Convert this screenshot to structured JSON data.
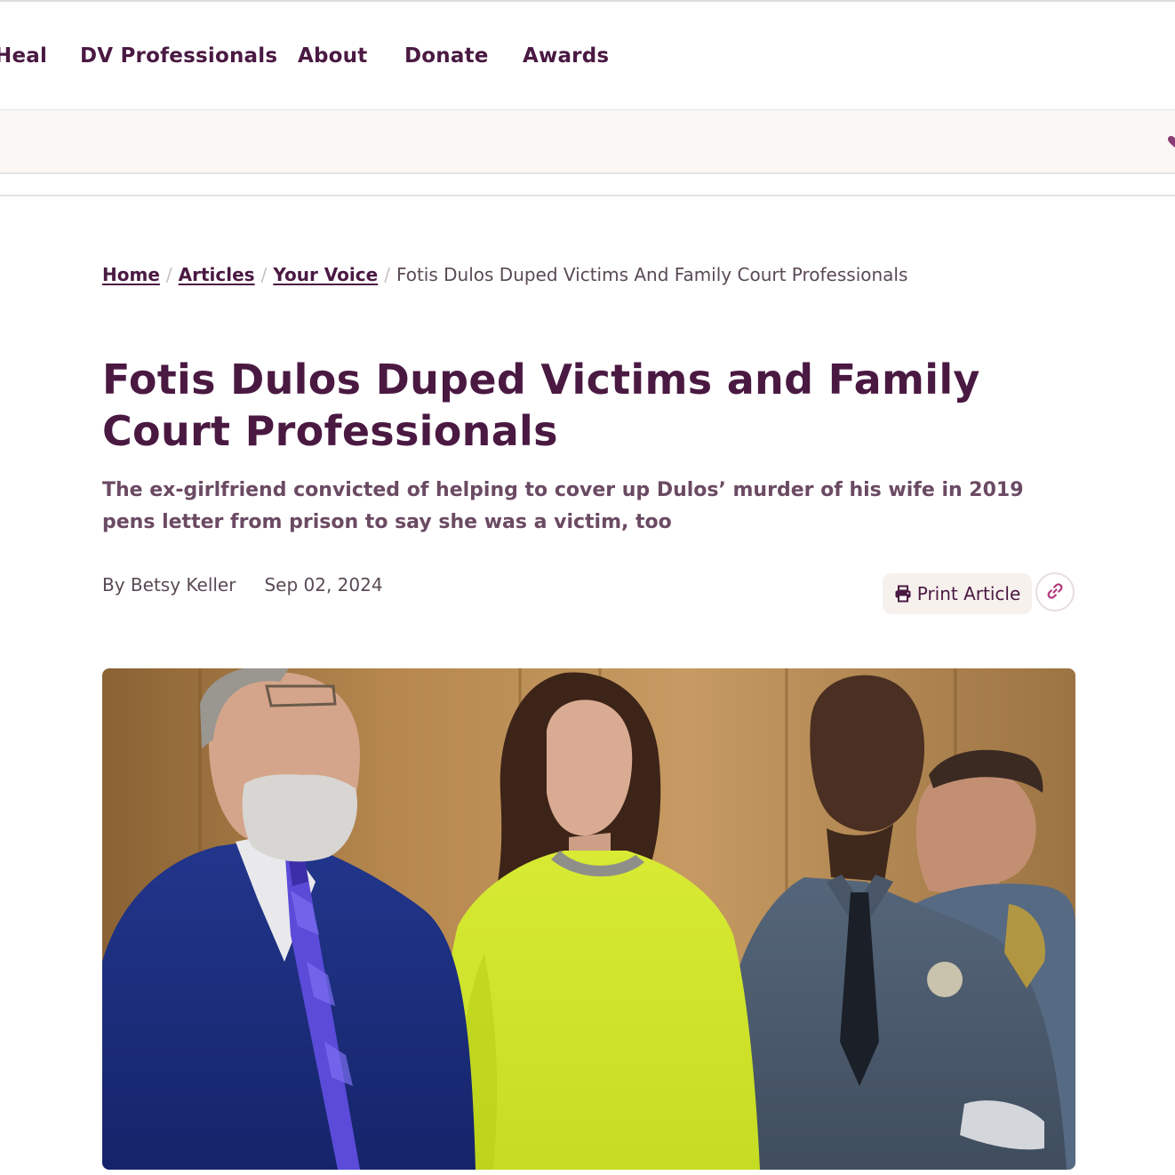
{
  "nav": {
    "items": [
      {
        "label": "Heal"
      },
      {
        "label": "DV Professionals"
      },
      {
        "label": "About"
      },
      {
        "label": "Donate"
      },
      {
        "label": "Awards"
      }
    ]
  },
  "breadcrumb": {
    "items": [
      {
        "label": "Home"
      },
      {
        "label": "Articles"
      },
      {
        "label": "Your Voice"
      }
    ],
    "separator": "/",
    "current": "Fotis Dulos Duped Victims And Family Court Professionals"
  },
  "article": {
    "title": "Fotis Dulos Duped Victims and Family Court Professionals",
    "subtitle": "The ex-girlfriend convicted of helping to cover up Dulos’ murder of his wife in 2019 pens letter from prison to say she was a victim, too",
    "author": "By Betsy Keller",
    "date": "Sep 02, 2024",
    "print_label": "Print Article",
    "hero_image": "courtroom-photo"
  },
  "icons": {
    "print": "printer-icon",
    "link": "link-icon",
    "promo": "heart-icon"
  },
  "colors": {
    "brand": "#4a1942",
    "accent": "#b0367a",
    "band_bg": "#fbf7f4"
  }
}
